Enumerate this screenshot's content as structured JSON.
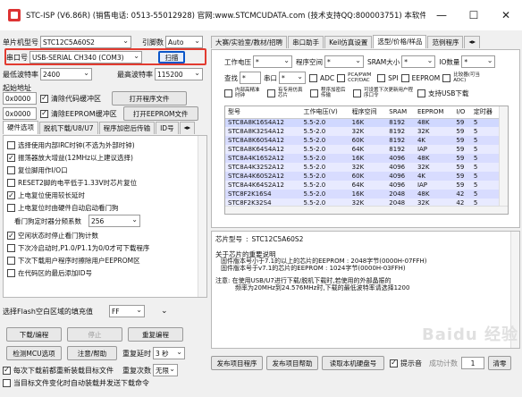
{
  "window": {
    "title": "STC-ISP (V6.86R) (销售电话: 0513-55012928) 官网:www.STCMCUDATA.com (技术支持QQ:800003751) 本软件...",
    "minimize": "—",
    "maximize": "☐",
    "close": "✕"
  },
  "left": {
    "mcu_label": "单片机型号",
    "mcu_value": "STC12C5A60S2",
    "pin_label": "引脚数",
    "pin_value": "Auto",
    "port_label": "串口号",
    "port_value": "USB-SERIAL CH340 (COM3)",
    "scan_button": "扫描",
    "min_baud_label": "最低波特率",
    "min_baud_value": "2400",
    "max_baud_label": "最高波特率",
    "max_baud_value": "115200",
    "start_addr_label": "起始地址",
    "addr1": "0x0000",
    "clear_code_label": "清除代码缓冲区",
    "open_program_button": "打开程序文件",
    "addr2": "0x0000",
    "clear_eeprom_label": "清除EEPROM缓冲区",
    "open_eeprom_button": "打开EEPROM文件",
    "tabs": [
      "硬件选项",
      "脱机下载/U8/U7",
      "程序加密后传输",
      "ID号"
    ],
    "options": [
      {
        "label": "选择使用内部IRC时钟(不选为外部时钟)",
        "checked": false
      },
      {
        "label": "振荡器放大增益(12MHz以上建议选择)",
        "checked": true
      },
      {
        "label": "复位脚用作I/O口",
        "checked": false
      },
      {
        "label": "RESET2脚的电平低于1.33V时芯片复位",
        "checked": false
      },
      {
        "label": "上电复位使用较长延时",
        "checked": true
      },
      {
        "label": "上电复位时由硬件自动启动看门狗",
        "checked": false
      }
    ],
    "wdt_label": "看门狗定时器分频系数",
    "wdt_value": "256",
    "options2": [
      {
        "label": "空闲状态时停止看门狗计数",
        "checked": true
      },
      {
        "label": "下次冷启动时,P1.0/P1.1为0/0才可下载程序",
        "checked": false
      },
      {
        "label": "下次下载用户程序时擦除用户EEPROM区",
        "checked": false
      },
      {
        "label": "在代码区的最后添加ID号",
        "checked": false
      }
    ],
    "fill_label": "选择Flash空白区域的填充值",
    "fill_value": "FF",
    "download_button": "下载/编程",
    "stop_button": "停止",
    "reprogram_button": "重复编程",
    "check_mcu_button": "检测MCU选项",
    "help_button": "注意/帮助",
    "repeat_delay_label": "重复延时",
    "repeat_delay_value": "3 秒",
    "reload_label": "每次下载前都重新装载目标文件",
    "reload_checked": true,
    "repeat_count_label": "重复次数",
    "repeat_count_value": "无限",
    "auto_send_label": "当目标文件变化时自动装载并发送下载命令",
    "auto_send_checked": false
  },
  "right": {
    "tabs": [
      "大赛/实验室/教材/招聘",
      "串口助手",
      "Keil仿真设置",
      "选型/价格/样品",
      "范例程序"
    ],
    "filter": {
      "voltage_label": "工作电压",
      "voltage_value": "*",
      "space_label": "程序空间",
      "space_value": "*",
      "sram_label": "SRAM大小",
      "sram_value": "*",
      "io_label": "IO数量",
      "io_value": "*",
      "search_label": "查找",
      "search_value": "*",
      "uart_label": "串口",
      "uart_value": "*",
      "checks": [
        "ADC",
        "PCA/PWM CCP/DAC",
        "SPI",
        "EEPROM",
        "比较器(可当ADC)"
      ],
      "checks2": [
        "内部高精准时钟",
        "有专用仿真芯片",
        "程序加密后传输",
        "可设置下次更新用户程序口令",
        "支持USB下载"
      ],
      "lvd_label": "比较器(可当ADC)低压检测"
    },
    "table": {
      "headers": [
        "型号",
        "工作电压(V)",
        "程序空间",
        "SRAM",
        "EEPROM",
        "I/O",
        "定时器"
      ],
      "rows": [
        [
          "STC8A8K16S4A12",
          "5.5-2.0",
          "16K",
          "8192",
          "48K",
          "59",
          "5"
        ],
        [
          "STC8A8K32S4A12",
          "5.5-2.0",
          "32K",
          "8192",
          "32K",
          "59",
          "5"
        ],
        [
          "STC8A8K60S4A12",
          "5.5-2.0",
          "60K",
          "8192",
          "4K",
          "59",
          "5"
        ],
        [
          "STC8A8K64S4A12",
          "5.5-2.0",
          "64K",
          "8192",
          "IAP",
          "59",
          "5"
        ],
        [
          "STC8A4K16S2A12",
          "5.5-2.0",
          "16K",
          "4096",
          "48K",
          "59",
          "5"
        ],
        [
          "STC8A4K32S2A12",
          "5.5-2.0",
          "32K",
          "4096",
          "32K",
          "59",
          "5"
        ],
        [
          "STC8A4K60S2A12",
          "5.5-2.0",
          "60K",
          "4096",
          "4K",
          "59",
          "5"
        ],
        [
          "STC8A4K64S2A12",
          "5.5-2.0",
          "64K",
          "4096",
          "IAP",
          "59",
          "5"
        ],
        [
          "STC8F2K16S4",
          "5.5-2.0",
          "16K",
          "2048",
          "48K",
          "42",
          "5"
        ],
        [
          "STC8F2K32S4",
          "5.5-2.0",
          "32K",
          "2048",
          "32K",
          "42",
          "5"
        ]
      ]
    },
    "info": {
      "model_label": "芯片型号",
      "model_value": "STC12C5A60S2",
      "line1": "关于芯片的重要说明",
      "line2": "固件版本号小于7.1的以上的芯片的EEPROM      : 2048字节(0000H-07FFH)",
      "line3": "固件版本号于v7.1的芯片的EEPROM      : 1024字节(0000H-03FFH)",
      "note": "注意: 在使用USB/U7进行下载/脱机下载时,若使用的外部晶振的",
      "note2": "频率为20MHz到24.576MHz时,下载的最低波特率请选择1200"
    },
    "bottom": {
      "save_button": "发布项目程序",
      "help_button": "发布项目帮助",
      "read_button": "读取本机硬盘号",
      "tip_label": "提示音",
      "success_label": "成功计数",
      "count_value": "1",
      "clear_button": "清零"
    }
  },
  "watermark": "Baidu 经验"
}
